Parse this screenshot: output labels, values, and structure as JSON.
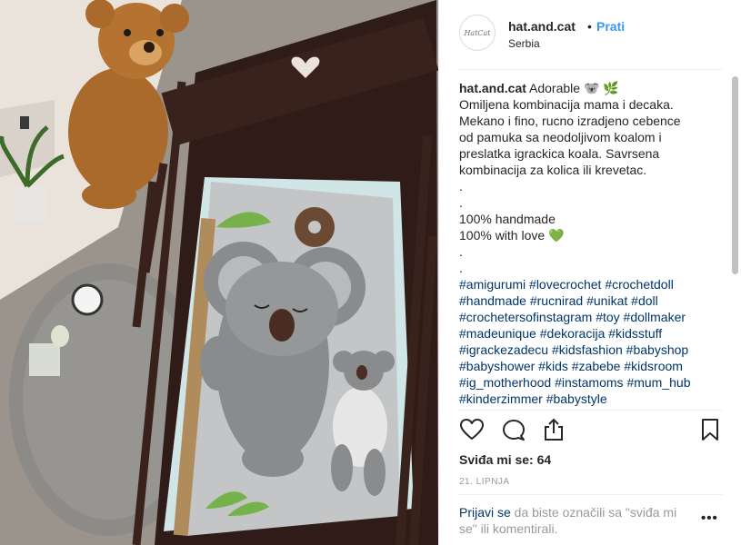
{
  "post": {
    "username": "hat.and.cat",
    "follow_dot": "•",
    "follow_label": "Prati",
    "location": "Serbia",
    "avatar_text": "HatCat"
  },
  "caption": {
    "username": "hat.and.cat",
    "first_line": " Adorable 🐨 🌿",
    "lines": [
      "Omiljena kombinacija mama i decaka.",
      "Mekano i fino, rucno izradjeno cebence",
      "od pamuka sa neodoljivom koalom i",
      "preslatka igrackica koala. Savrsena",
      "kombinacija za kolica ili krevetac.",
      ".",
      ".",
      "100% handmade",
      "100% with love 💚",
      ".",
      "."
    ],
    "hashtag_lines": [
      [
        "#amigurumi",
        "#lovecrochet",
        "#crochetdoll"
      ],
      [
        "#handmade",
        "#rucnirad",
        "#unikat",
        "#doll"
      ],
      [
        "#crochetersofinstagram",
        "#toy",
        "#dollmaker"
      ],
      [
        "#madeunique",
        "#dekoracija",
        "#kidsstuff"
      ],
      [
        "#igrackezadecu",
        "#kidsfashion",
        "#babyshop"
      ],
      [
        "#babyshower",
        "#kids",
        "#zabebe",
        "#kidsroom"
      ],
      [
        "#ig_motherhood",
        "#instamoms",
        "#mum_hub"
      ],
      [
        "#kinderzimmer",
        "#babystyle"
      ]
    ]
  },
  "actions": {
    "like_icon": "heart-icon",
    "comment_icon": "comment-icon",
    "share_icon": "share-icon",
    "save_icon": "bookmark-icon"
  },
  "likes_text": "Sviđa mi se: 64",
  "date_text": "21. LIPNJA",
  "login": {
    "link_label": "Prijavi se",
    "rest_text": " da biste označili sa \"sviđa mi se\" ili komentirali.",
    "more_label": "•••"
  },
  "colors": {
    "link_blue": "#3897f0",
    "hashtag_blue": "#003569",
    "muted_grey": "#999999"
  }
}
